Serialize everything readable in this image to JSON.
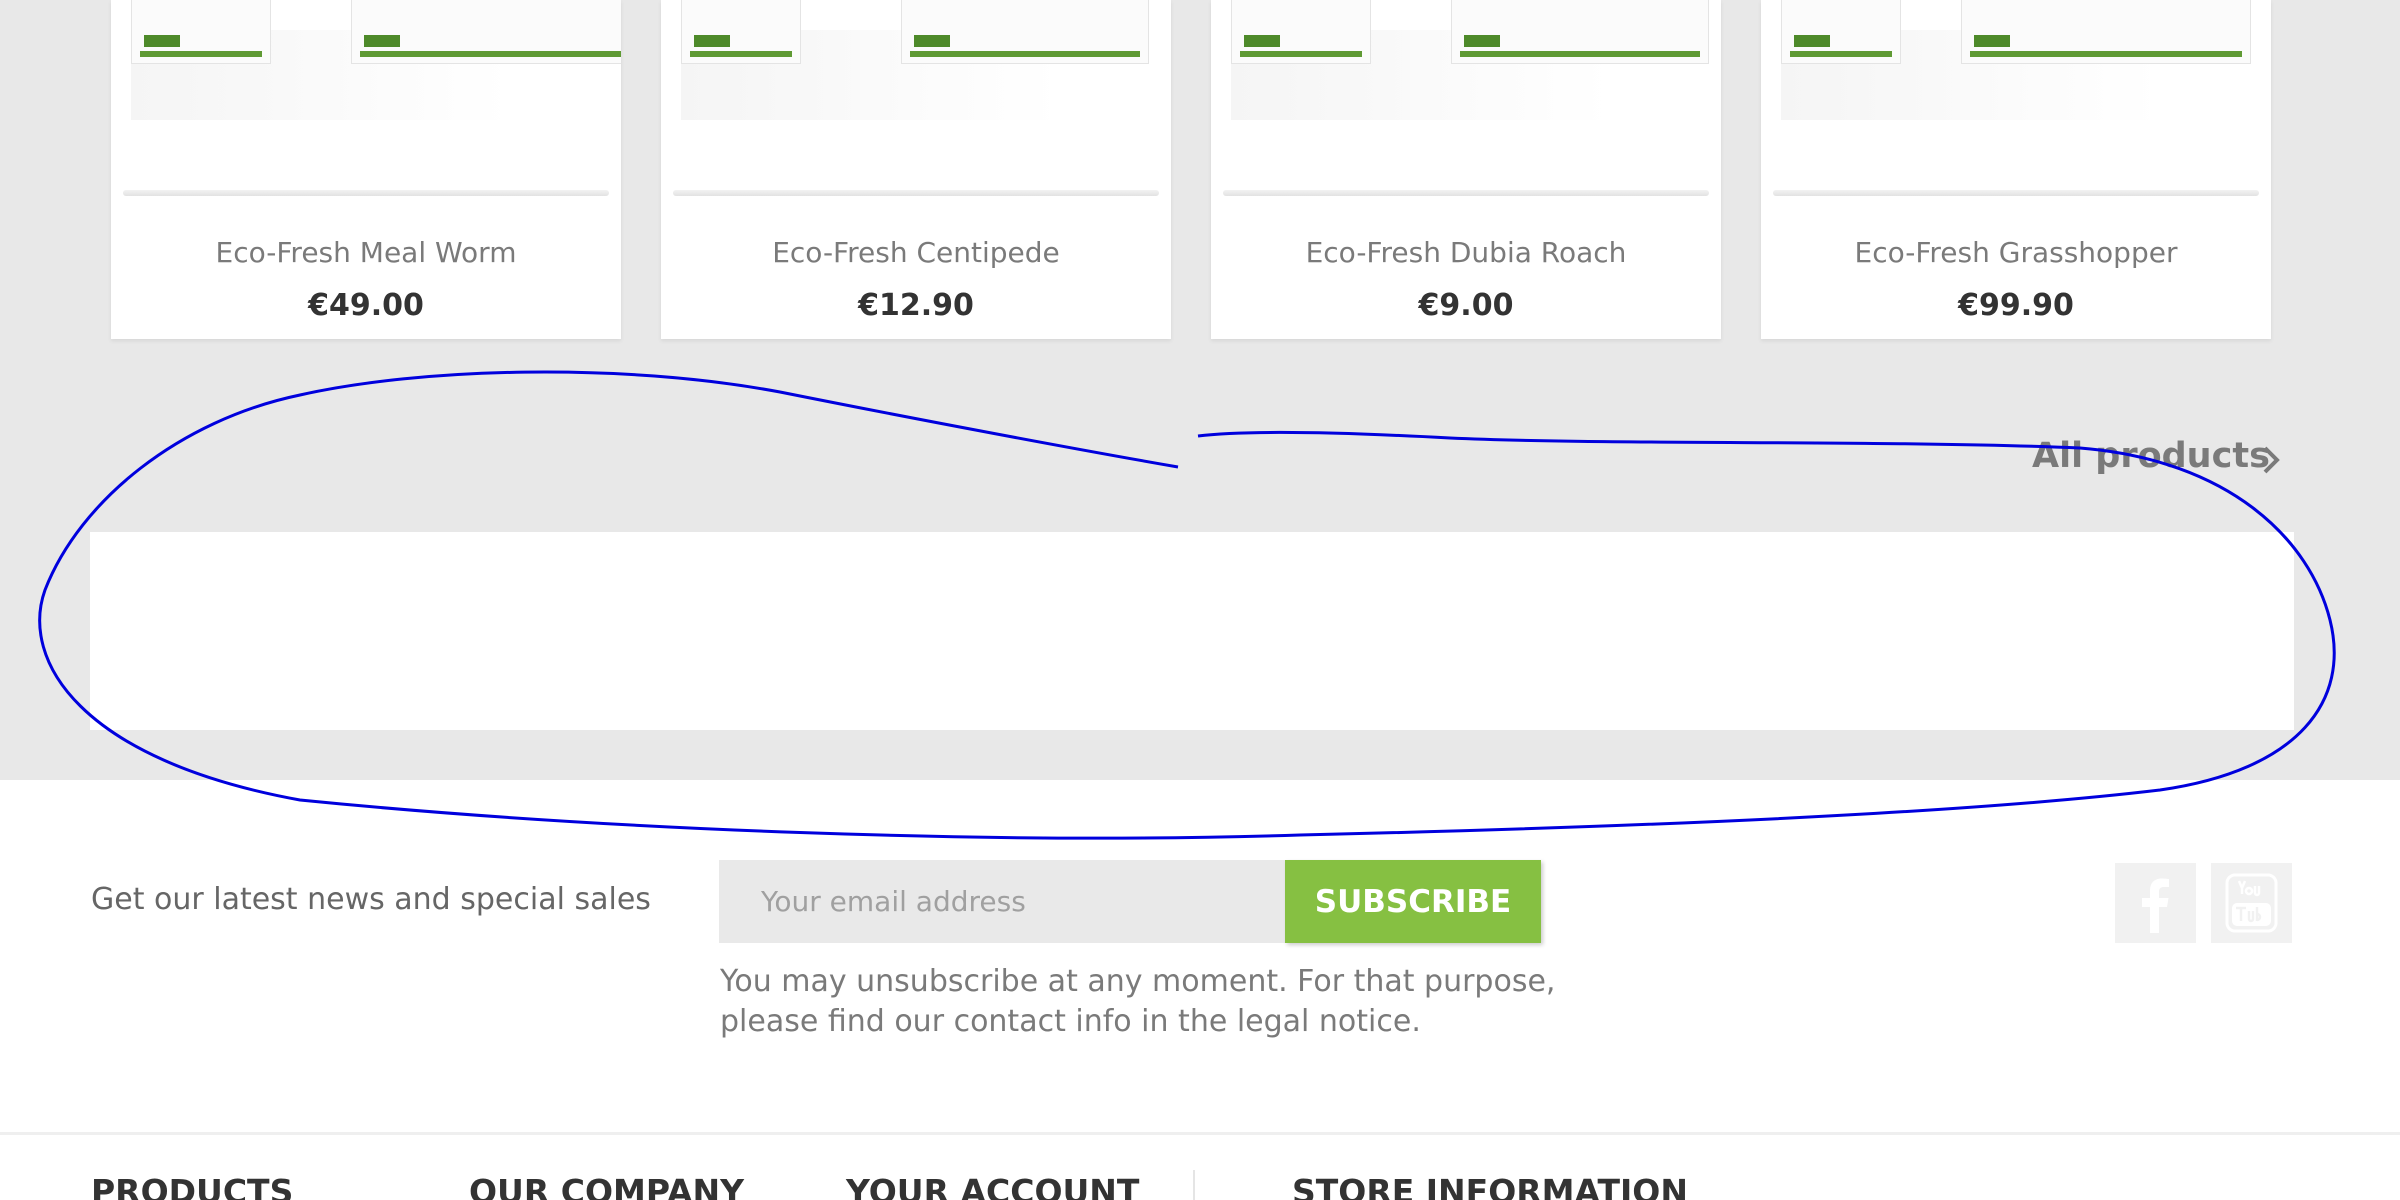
{
  "products": [
    {
      "name": "Eco-Fresh Meal Worm",
      "price": "€49.00"
    },
    {
      "name": "Eco-Fresh Centipede",
      "price": "€12.90"
    },
    {
      "name": "Eco-Fresh Dubia Roach",
      "price": "€9.00"
    },
    {
      "name": "Eco-Fresh Grasshopper",
      "price": "€99.90"
    }
  ],
  "all_products_link": "All products",
  "newsletter": {
    "label": "Get our latest news and special sales",
    "placeholder": "Your email address",
    "button": "SUBSCRIBE",
    "legal_line1": "You may unsubscribe at any moment. For that purpose,",
    "legal_line2": "please find our contact info in the legal notice."
  },
  "footer": {
    "col1": "PRODUCTS",
    "col2": "OUR COMPANY",
    "col3": "YOUR ACCOUNT",
    "col4": "STORE INFORMATION"
  },
  "colors": {
    "accent_green": "#86c042",
    "annotation_blue": "#0000dd",
    "band_gray": "#e8e8e8"
  },
  "icons": [
    "chevron-right-icon",
    "facebook-icon",
    "youtube-icon"
  ]
}
